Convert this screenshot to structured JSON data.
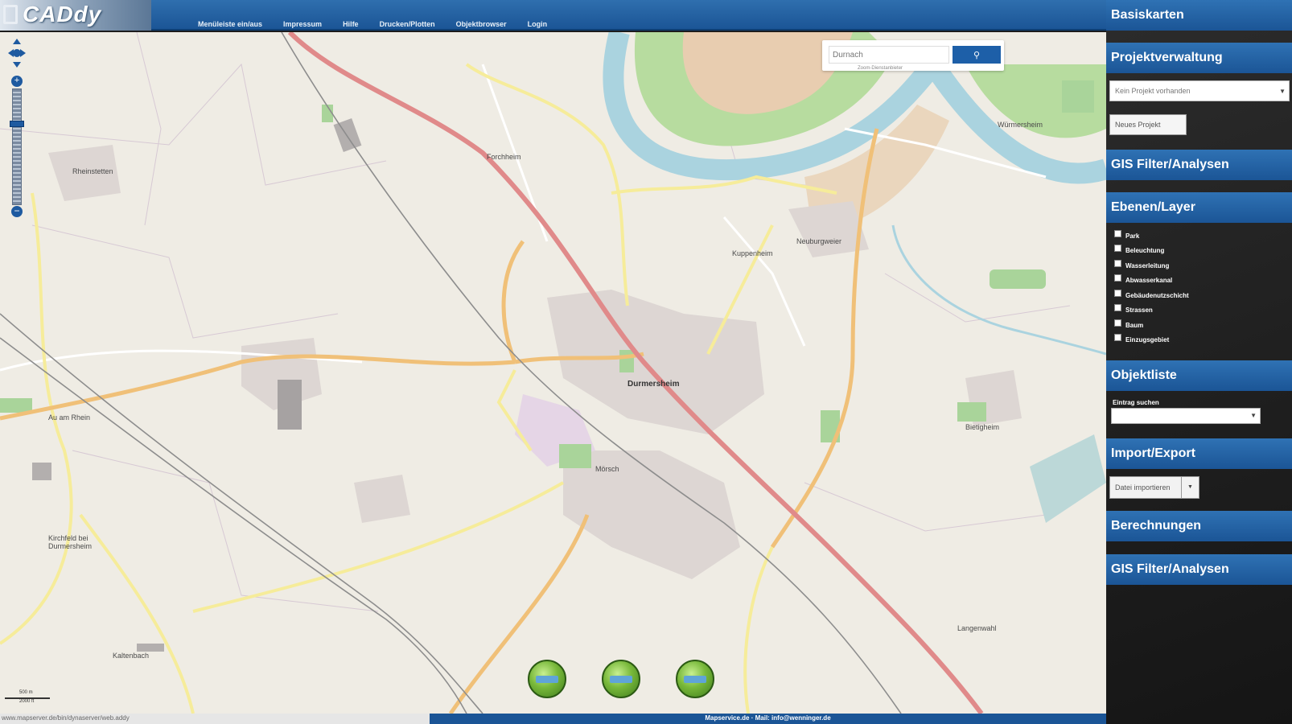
{
  "app": {
    "logo_text": "CADdy"
  },
  "menu": [
    "Menüleiste ein/aus",
    "Impressum",
    "Hilfe",
    "Drucken/Plotten",
    "Objektbrowser",
    "Login"
  ],
  "search": {
    "placeholder": "Durnach",
    "button_icon": "search-icon",
    "hint": "Zoom-Dienstanbieter"
  },
  "map": {
    "places": {
      "durmersheim": "Durmersheim",
      "mörsch": "Mörsch",
      "kirchenklingen": "Kirchfeld bei Durmersheim",
      "neuburgweier": "Neuburgweier",
      "au": "Au am Rhein",
      "forchheim": "Forchheim",
      "wuerm": "Würmersheim",
      "bietigheim": "Bietigheim",
      "ortsteil": "Rheinstetten",
      "kuppenheim": "Kuppenheim",
      "langenwahl": "Langenwahl",
      "kaltenbach": "Kaltenbach"
    },
    "scale": {
      "top": "500 m",
      "bottom": "2000 ft"
    }
  },
  "statusbar": {
    "url": "www.mapserver.de/bin/dynaserver/web.addy"
  },
  "footer": {
    "text": "Mapservice.de · Mail: info@wenninger.de"
  },
  "sidebar": {
    "basiskarten": "Basiskarten",
    "projektverwaltung": "Projektverwaltung",
    "project_select": "Kein Projekt vorhanden",
    "new_project": "Neues Projekt",
    "gis_filter_1": "GIS Filter/Analysen",
    "ebenen": "Ebenen/Layer",
    "layers": [
      "Park",
      "Beleuchtung",
      "Wasserleitung",
      "Abwasserkanal",
      "Gebäudenutzschicht",
      "Strassen",
      "Baum",
      "Einzugsgebiet"
    ],
    "objektliste": "Objektliste",
    "entry_label": "Eintrag suchen",
    "import_export": "Import/Export",
    "import_button": "Datei importieren",
    "berechnungen": "Berechnungen",
    "gis_filter_2": "GIS Filter/Analysen"
  },
  "colors": {
    "accent": "#1b5596",
    "map_bg": "#efece4",
    "main_road": "#e07a7a",
    "secondary_road": "#f0c078",
    "water": "#aad3df",
    "forest": "#a9d49a"
  }
}
